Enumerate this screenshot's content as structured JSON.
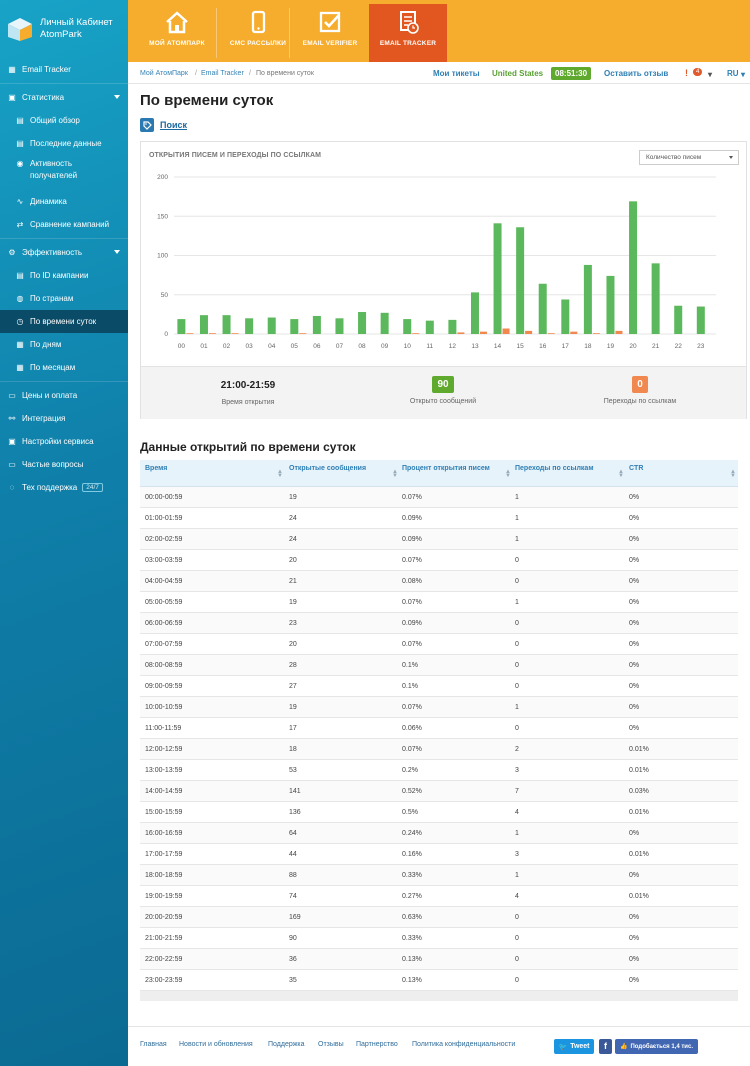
{
  "brand": {
    "line1": "Личный Кабинет",
    "line2": "AtomPark"
  },
  "sidebar": {
    "items": [
      {
        "label": "Email Tracker",
        "icon": "grid-icon"
      },
      {
        "label": "Статистика",
        "icon": "chart-icon"
      },
      {
        "label": "Общий обзор",
        "icon": "doc-icon"
      },
      {
        "label": "Последние данные",
        "icon": "doc-icon"
      },
      {
        "label": "Активность получателей",
        "icon": "target-icon"
      },
      {
        "label": "Динамика",
        "icon": "wave-icon"
      },
      {
        "label": "Сравнение кампаний",
        "icon": "compare-icon"
      },
      {
        "label": "Эффективность",
        "icon": "gear-icon"
      },
      {
        "label": "По ID кампании",
        "icon": "list-icon"
      },
      {
        "label": "По странам",
        "icon": "globe-icon"
      },
      {
        "label": "По времени суток",
        "icon": "clock-icon"
      },
      {
        "label": "По дням",
        "icon": "calendar-icon"
      },
      {
        "label": "По месяцам",
        "icon": "calendar-icon"
      },
      {
        "label": "Цены и оплата",
        "icon": "card-icon"
      },
      {
        "label": "Интеграция",
        "icon": "link-icon"
      },
      {
        "label": "Настройки сервиса",
        "icon": "settings-icon"
      },
      {
        "label": "Частые вопросы",
        "icon": "question-icon"
      },
      {
        "label": "Тех поддержка",
        "icon": "support-icon",
        "badge": "24/7"
      }
    ]
  },
  "topnav": [
    {
      "label": "МОЙ АТОМПАРК"
    },
    {
      "label": "СМС РАССЫЛКИ"
    },
    {
      "label": "EMAIL VERIFIER"
    },
    {
      "label": "EMAIL TRACKER"
    }
  ],
  "breadcrumb": {
    "home": "Мой АтомПарк",
    "section": "Email Tracker",
    "current": "По времени суток"
  },
  "topright": {
    "tickets": "Мои тикеты",
    "country": "United States",
    "time": "08:51:30",
    "feedback": "Оставить отзыв",
    "notif_count": "4",
    "lang": "RU"
  },
  "page": {
    "title": "По времени суток",
    "search": "Поиск"
  },
  "chart": {
    "title": "ОТКРЫТИЯ ПИСЕМ И ПЕРЕХОДЫ ПО ССЫЛКАМ",
    "select": "Количество писем",
    "colors": {
      "opens": "#5cb85c",
      "clicks": "#f0884f"
    }
  },
  "chart_data": {
    "type": "bar",
    "categories": [
      "00",
      "01",
      "02",
      "03",
      "04",
      "05",
      "06",
      "07",
      "08",
      "09",
      "10",
      "11",
      "12",
      "13",
      "14",
      "15",
      "16",
      "17",
      "18",
      "19",
      "20",
      "21",
      "22",
      "23"
    ],
    "series": [
      {
        "values": [
          19,
          24,
          24,
          20,
          21,
          19,
          23,
          20,
          28,
          27,
          19,
          17,
          18,
          53,
          141,
          136,
          64,
          44,
          88,
          74,
          169,
          90,
          36,
          35
        ]
      },
      {
        "values": [
          1,
          1,
          1,
          0,
          0,
          1,
          0,
          0,
          0,
          0,
          1,
          0,
          2,
          3,
          7,
          4,
          1,
          3,
          1,
          4,
          0,
          0,
          0,
          0
        ]
      }
    ],
    "yticks": [
      0,
      50,
      100,
      150,
      200
    ],
    "ylim": [
      0,
      200
    ],
    "grid": true
  },
  "stats": {
    "time": "21:00-21:59",
    "time_label": "Время открытия",
    "opened": "90",
    "opened_label": "Открыто сообщений",
    "clicks": "0",
    "clicks_label": "Переходы по ссылкам"
  },
  "table": {
    "title": "Данные открытий по времени суток",
    "headers": [
      "Время",
      "Открытые сообщения",
      "Процент открытия писем",
      "Переходы по ссылкам",
      "CTR"
    ],
    "rows": [
      [
        "00:00-00:59",
        "19",
        "0.07%",
        "1",
        "0%"
      ],
      [
        "01:00-01:59",
        "24",
        "0.09%",
        "1",
        "0%"
      ],
      [
        "02:00-02:59",
        "24",
        "0.09%",
        "1",
        "0%"
      ],
      [
        "03:00-03:59",
        "20",
        "0.07%",
        "0",
        "0%"
      ],
      [
        "04:00-04:59",
        "21",
        "0.08%",
        "0",
        "0%"
      ],
      [
        "05:00-05:59",
        "19",
        "0.07%",
        "1",
        "0%"
      ],
      [
        "06:00-06:59",
        "23",
        "0.09%",
        "0",
        "0%"
      ],
      [
        "07:00-07:59",
        "20",
        "0.07%",
        "0",
        "0%"
      ],
      [
        "08:00-08:59",
        "28",
        "0.1%",
        "0",
        "0%"
      ],
      [
        "09:00-09:59",
        "27",
        "0.1%",
        "0",
        "0%"
      ],
      [
        "10:00-10:59",
        "19",
        "0.07%",
        "1",
        "0%"
      ],
      [
        "11:00-11:59",
        "17",
        "0.06%",
        "0",
        "0%"
      ],
      [
        "12:00-12:59",
        "18",
        "0.07%",
        "2",
        "0.01%"
      ],
      [
        "13:00-13:59",
        "53",
        "0.2%",
        "3",
        "0.01%"
      ],
      [
        "14:00-14:59",
        "141",
        "0.52%",
        "7",
        "0.03%"
      ],
      [
        "15:00-15:59",
        "136",
        "0.5%",
        "4",
        "0.01%"
      ],
      [
        "16:00-16:59",
        "64",
        "0.24%",
        "1",
        "0%"
      ],
      [
        "17:00-17:59",
        "44",
        "0.16%",
        "3",
        "0.01%"
      ],
      [
        "18:00-18:59",
        "88",
        "0.33%",
        "1",
        "0%"
      ],
      [
        "19:00-19:59",
        "74",
        "0.27%",
        "4",
        "0.01%"
      ],
      [
        "20:00-20:59",
        "169",
        "0.63%",
        "0",
        "0%"
      ],
      [
        "21:00-21:59",
        "90",
        "0.33%",
        "0",
        "0%"
      ],
      [
        "22:00-22:59",
        "36",
        "0.13%",
        "0",
        "0%"
      ],
      [
        "23:00-23:59",
        "35",
        "0.13%",
        "0",
        "0%"
      ]
    ]
  },
  "footer": {
    "links": [
      "Главная",
      "Новости и обновления",
      "Поддержка",
      "Отзывы",
      "Партнерство",
      "Политика конфиденциальности"
    ],
    "tweet": "Tweet",
    "fb": "f",
    "like": "Подобається 1,4 тис."
  }
}
